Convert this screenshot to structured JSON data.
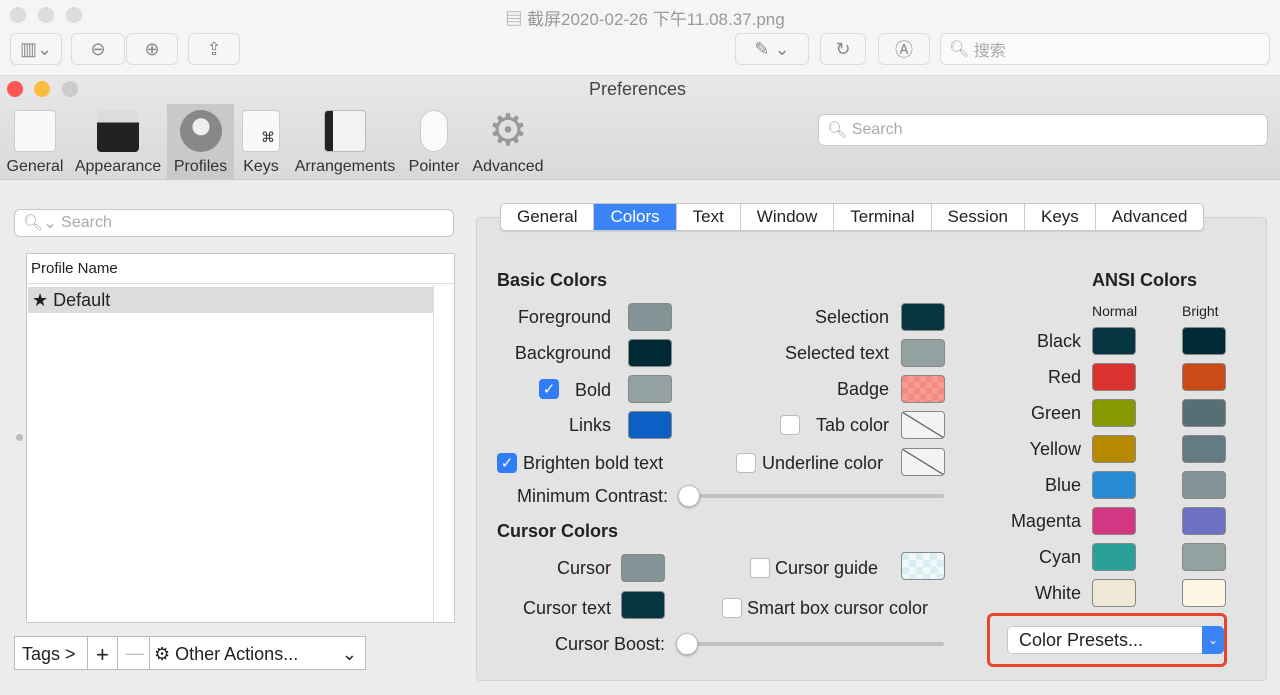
{
  "preview": {
    "title": "截屏2020-02-26 下午11.08.37.png",
    "search_placeholder": "搜索"
  },
  "prefs": {
    "title": "Preferences",
    "search_placeholder": "Search",
    "toolbar": [
      {
        "label": "General"
      },
      {
        "label": "Appearance"
      },
      {
        "label": "Profiles"
      },
      {
        "label": "Keys"
      },
      {
        "label": "Arrangements"
      },
      {
        "label": "Pointer"
      },
      {
        "label": "Advanced"
      }
    ]
  },
  "profiles": {
    "search_placeholder": "Search",
    "column": "Profile Name",
    "items": [
      {
        "label": "Default",
        "star": "★"
      }
    ],
    "tags": "Tags >",
    "add": "+",
    "remove": "—",
    "other_actions": "Other Actions..."
  },
  "tabs": [
    {
      "label": "General"
    },
    {
      "label": "Colors"
    },
    {
      "label": "Text"
    },
    {
      "label": "Window"
    },
    {
      "label": "Terminal"
    },
    {
      "label": "Session"
    },
    {
      "label": "Keys"
    },
    {
      "label": "Advanced"
    }
  ],
  "basic": {
    "heading": "Basic Colors",
    "foreground": "Foreground",
    "background": "Background",
    "bold": "Bold",
    "links": "Links",
    "selection": "Selection",
    "selected_text": "Selected text",
    "badge": "Badge",
    "tab_color": "Tab color",
    "brighten": "Brighten bold text",
    "underline": "Underline color",
    "min_contrast": "Minimum Contrast:",
    "colors": {
      "foreground": "#839496",
      "background": "#002b36",
      "bold": "#93a1a1",
      "links": "#0b5fc5",
      "selection": "#073642",
      "selected_text": "#93a1a1",
      "badge": "#f38a80"
    },
    "checked": {
      "bold": true,
      "brighten": true,
      "tab_color": false,
      "underline": false
    },
    "min_contrast_value": 0
  },
  "cursor": {
    "heading": "Cursor Colors",
    "cursor": "Cursor",
    "cursor_text": "Cursor text",
    "guide": "Cursor guide",
    "smart_box": "Smart box cursor color",
    "boost": "Cursor Boost:",
    "colors": {
      "cursor": "#839496",
      "cursor_text": "#073642",
      "guide": "#d9eef2"
    },
    "boost_value": 0
  },
  "ansi": {
    "heading": "ANSI Colors",
    "normal": "Normal",
    "bright": "Bright",
    "rows": [
      {
        "name": "Black",
        "normal": "#073642",
        "bright": "#002b36"
      },
      {
        "name": "Red",
        "normal": "#dc322f",
        "bright": "#cb4b16"
      },
      {
        "name": "Green",
        "normal": "#859900",
        "bright": "#586e75"
      },
      {
        "name": "Yellow",
        "normal": "#b58900",
        "bright": "#657b83"
      },
      {
        "name": "Blue",
        "normal": "#268bd2",
        "bright": "#839496"
      },
      {
        "name": "Magenta",
        "normal": "#d33682",
        "bright": "#6c71c4"
      },
      {
        "name": "Cyan",
        "normal": "#2aa198",
        "bright": "#93a1a1"
      },
      {
        "name": "White",
        "normal": "#eee8d5",
        "bright": "#fdf6e3"
      }
    ]
  },
  "presets": {
    "label": "Color Presets...",
    "highlight": "#e8452c"
  }
}
